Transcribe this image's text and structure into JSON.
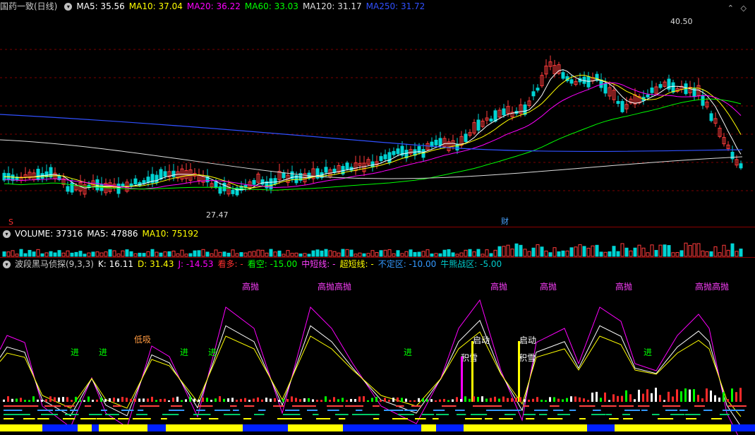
{
  "price_pane": {
    "title": "国药一致(日线)",
    "ma": [
      {
        "label": "MA5: 35.56",
        "color": "#ffffff"
      },
      {
        "label": "MA10: 37.04",
        "color": "#ffff00"
      },
      {
        "label": "MA20: 36.22",
        "color": "#ff00ff"
      },
      {
        "label": "MA60: 33.03",
        "color": "#00ff00"
      },
      {
        "label": "MA120: 31.17",
        "color": "#dddddd"
      },
      {
        "label": "MA250: 31.72",
        "color": "#3050ff"
      }
    ],
    "high_label": "40.50",
    "low_label": "27.47",
    "marker_s": "S",
    "marker_cai": "财"
  },
  "volume_pane": {
    "items": [
      {
        "label": "VOLUME: 37316",
        "color": "#ffffff"
      },
      {
        "label": "MA5: 47886",
        "color": "#ffffff"
      },
      {
        "label": "MA10: 75192",
        "color": "#ffff00"
      }
    ]
  },
  "indicator_pane": {
    "title": "波段黑马侦探(9,3,3)",
    "items": [
      {
        "label": "K: 16.11",
        "color": "#ffffff"
      },
      {
        "label": "D: 31.43",
        "color": "#ffff00"
      },
      {
        "label": "J: -14.53",
        "color": "#ff00ff"
      },
      {
        "label": "看多: -",
        "color": "#ff3030"
      },
      {
        "label": "看空: -15.00",
        "color": "#00ff00"
      },
      {
        "label": "中短线: -",
        "color": "#ff40ff"
      },
      {
        "label": "超短线: -",
        "color": "#ffff00"
      },
      {
        "label": "不定区: -10.00",
        "color": "#3399ff"
      },
      {
        "label": "牛熊战区: -5.00",
        "color": "#00cccc"
      }
    ],
    "annotations": {
      "gaopao": "高抛",
      "gaopao2": "高抛高抛",
      "jin": "进",
      "dixi": "低吸",
      "qidong": "启动",
      "jixue": "积雪"
    }
  },
  "colors": {
    "up": "#ff3b3b",
    "down": "#00d4d4",
    "grid": "#7a0000",
    "k": "#ffffff",
    "d": "#ffff00",
    "j": "#ff00ff"
  }
}
